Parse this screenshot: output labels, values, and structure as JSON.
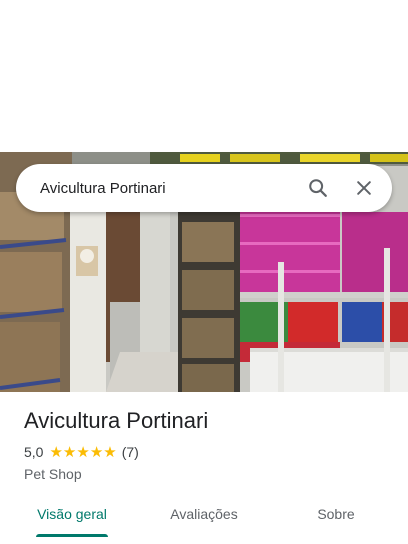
{
  "search": {
    "query": "Avicultura Portinari"
  },
  "icons": {
    "search": "search-icon",
    "close": "close-icon",
    "star": "star-icon"
  },
  "place": {
    "name": "Avicultura Portinari",
    "rating": "5,0",
    "stars": 5,
    "review_count": "(7)",
    "category": "Pet Shop"
  },
  "tabs": [
    {
      "label": "Visão geral",
      "active": true
    },
    {
      "label": "Avaliações",
      "active": false
    },
    {
      "label": "Sobre",
      "active": false
    }
  ],
  "colors": {
    "accent": "#00796b",
    "star": "#fbbc04"
  }
}
